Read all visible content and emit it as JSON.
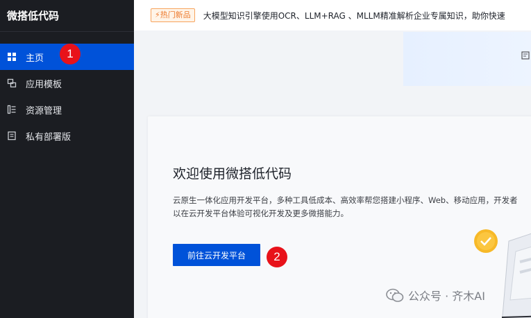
{
  "sidebar": {
    "brand": "微搭低代码",
    "items": [
      {
        "label": "主页",
        "icon": "grid-icon",
        "active": true
      },
      {
        "label": "应用模板",
        "icon": "template-icon",
        "active": false
      },
      {
        "label": "资源管理",
        "icon": "resource-icon",
        "active": false
      },
      {
        "label": "私有部署版",
        "icon": "document-icon",
        "active": false
      }
    ]
  },
  "notice": {
    "tag": "热门新品",
    "text": "大模型知识引擎使用OCR、LLM+RAG 、MLLM精准解析企业专属知识，助你快速"
  },
  "welcome": {
    "title": "欢迎使用微搭低代码",
    "desc_line1": "云原生一体化应用开发平台，多种工具低成本、高效率帮您搭建小程序、Web、移动应用，开发者",
    "desc_line2": "以在云开发平台体验可视化开发及更多微搭能力。",
    "button_label": "前往云开发平台"
  },
  "annotations": {
    "marker1": "1",
    "marker2": "2"
  },
  "watermark": {
    "text": "公众号 · 齐木AI"
  },
  "colors": {
    "sidebar_bg": "#1b1d22",
    "accent": "#0052d9",
    "tag_orange": "#ed7b2f",
    "marker_red": "#e8121a"
  }
}
